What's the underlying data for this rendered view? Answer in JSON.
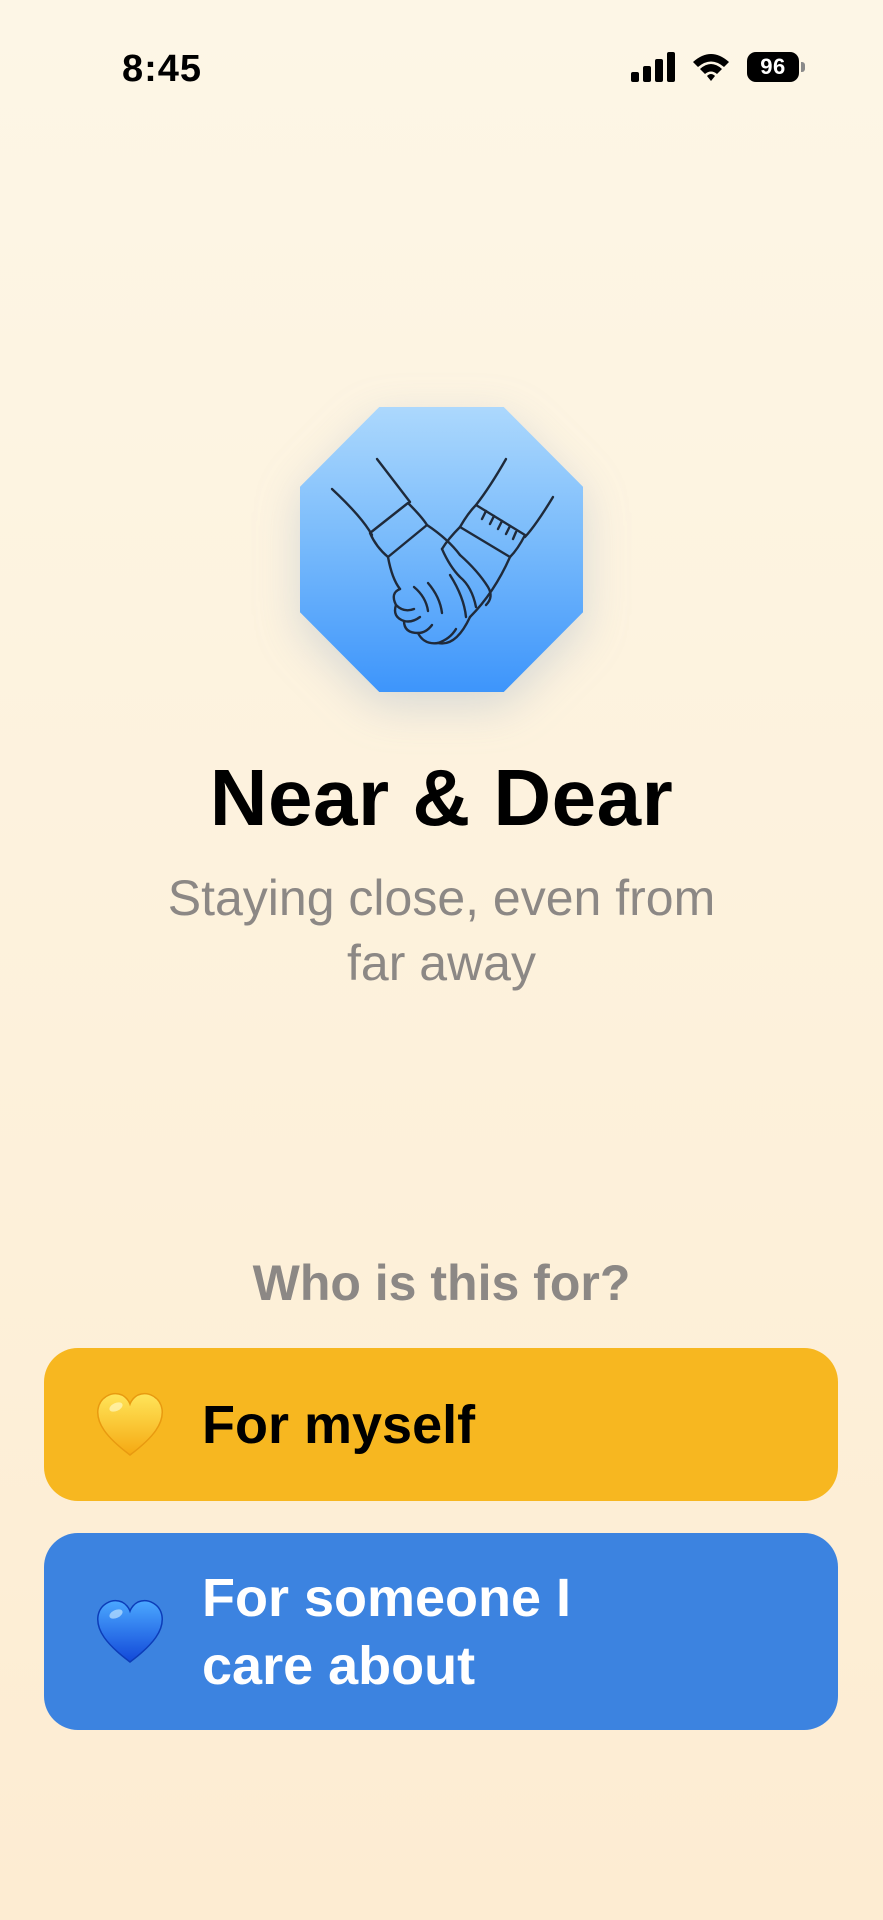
{
  "status_bar": {
    "time": "8:45",
    "battery": "96",
    "icons": [
      "cellular-signal-icon",
      "wifi-icon",
      "battery-icon"
    ]
  },
  "app": {
    "icon": "holding-hands-icon",
    "title": "Near & Dear",
    "subtitle": "Staying close, even from far away"
  },
  "prompt": {
    "question": "Who is this for?"
  },
  "choices": [
    {
      "label": "For myself",
      "icon": "yellow-heart-icon",
      "color": "#f7b720"
    },
    {
      "label": "For someone I care about",
      "icon": "blue-heart-icon",
      "color": "#3c83e0"
    }
  ],
  "colors": {
    "background": "#fdf3df",
    "icon_gradient_top": "#acd8fd",
    "icon_gradient_bottom": "#3d95fb",
    "muted_text": "#8c8885"
  }
}
